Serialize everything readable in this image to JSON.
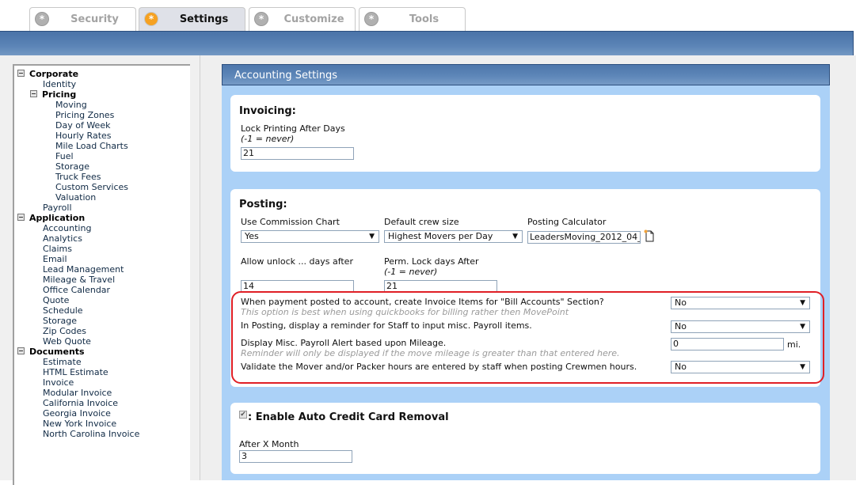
{
  "tabs": [
    {
      "label": "Security",
      "icon": "asterisk-icon",
      "active": false
    },
    {
      "label": "Settings",
      "icon": "asterisk-icon",
      "active": true
    },
    {
      "label": "Customize",
      "icon": "asterisk-icon",
      "active": false
    },
    {
      "label": "Tools",
      "icon": "asterisk-icon",
      "active": false
    }
  ],
  "sidebar": {
    "corporate": {
      "label": "Corporate",
      "items": [
        "Identity"
      ],
      "pricing": {
        "label": "Pricing",
        "items": [
          "Moving",
          "Pricing Zones",
          "Day of Week",
          "Hourly Rates",
          "Mile Load Charts",
          "Fuel",
          "Storage",
          "Truck Fees",
          "Custom Services",
          "Valuation"
        ]
      },
      "after_items": [
        "Payroll"
      ]
    },
    "application": {
      "label": "Application",
      "items": [
        "Accounting",
        "Analytics",
        "Claims",
        "Email",
        "Lead Management",
        "Mileage & Travel",
        "Office Calendar",
        "Quote",
        "Schedule",
        "Storage",
        "Zip Codes",
        "Web Quote"
      ]
    },
    "documents": {
      "label": "Documents",
      "items": [
        "Estimate",
        "HTML Estimate",
        "Invoice",
        "Modular Invoice",
        "California Invoice",
        "Georgia Invoice",
        "New York Invoice",
        "North Carolina Invoice"
      ]
    }
  },
  "panel": {
    "title": "Accounting Settings",
    "invoicing": {
      "heading": "Invoicing:",
      "lock_printing_label": "Lock Printing After Days",
      "lock_printing_hint": "(-1 = never)",
      "lock_printing_value": "21"
    },
    "posting": {
      "heading": "Posting:",
      "commission_label": "Use Commission Chart",
      "commission_value": "Yes",
      "crew_label": "Default crew size",
      "crew_value": "Highest Movers per Day",
      "calculator_label": "Posting Calculator",
      "calculator_value": "LeadersMoving_2012_04_",
      "unlock_label": "Allow unlock ... days after",
      "unlock_value": "14",
      "perm_lock_label": "Perm. Lock days After",
      "perm_lock_hint": "(-1 = never)",
      "perm_lock_value": "21",
      "options": [
        {
          "label": "When payment posted to account, create Invoice Items for \"Bill Accounts\" Section?",
          "hint": "This option is best when using quickbooks for billing rather then MovePoint",
          "value": "No"
        },
        {
          "label": "In Posting, display a reminder for Staff to input misc. Payroll items.",
          "value": "No"
        },
        {
          "label": "Display Misc. Payroll Alert based upon Mileage.",
          "hint": "Reminder will only be displayed if the move mileage is greater than that entered here.",
          "value": "0",
          "unit": "mi."
        },
        {
          "label": "Validate the Mover and/or Packer hours are entered by staff when posting Crewmen hours.",
          "value": "No"
        }
      ]
    },
    "credit_card": {
      "heading": ": Enable Auto Credit Card Removal",
      "checked": true,
      "after_label": "After X Month",
      "after_value": "3"
    }
  }
}
